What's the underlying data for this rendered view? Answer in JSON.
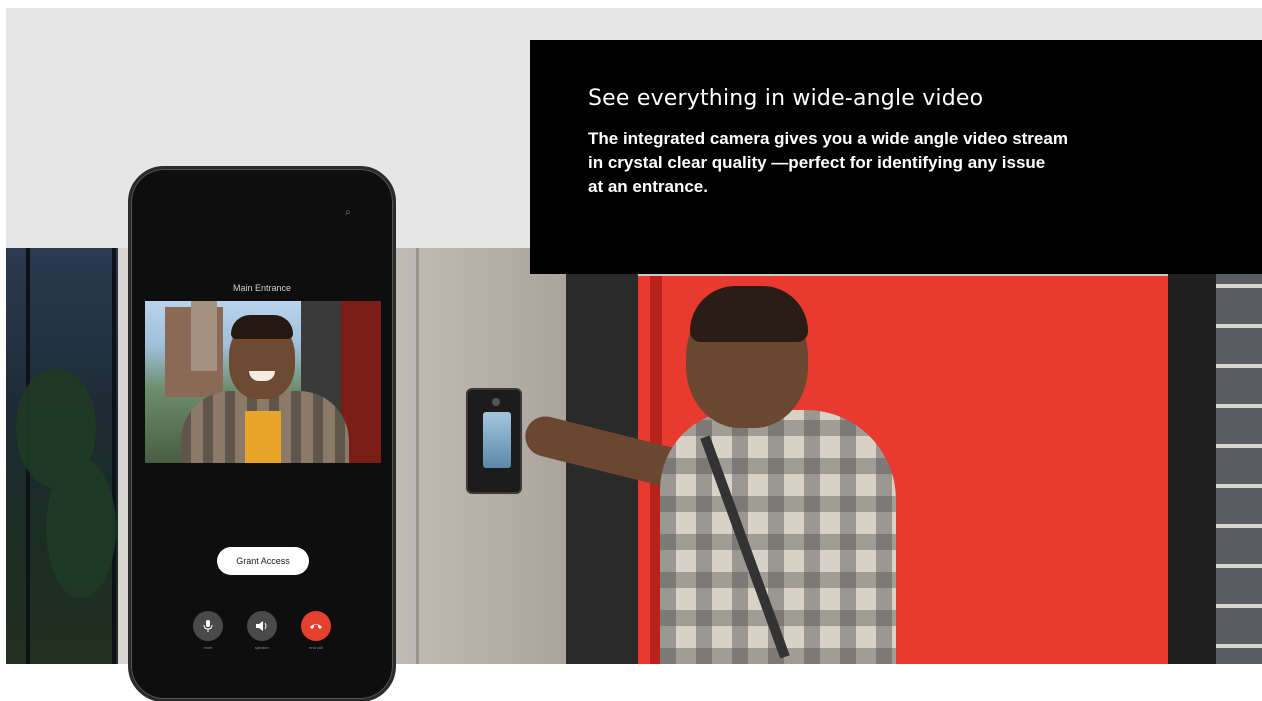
{
  "hero": {
    "heading": "See everything in wide-angle video",
    "body": "The integrated camera gives you a wide angle video stream\nin crystal clear quality —perfect for identifying any issue\n at an entrance."
  },
  "phone_app": {
    "entrance_label": "Main Entrance",
    "grant_access_label": "Grant Access",
    "controls": [
      {
        "icon": "microphone-icon",
        "label": "mute"
      },
      {
        "icon": "speaker-icon",
        "label": "speaker"
      },
      {
        "icon": "end-call-icon",
        "label": "end call"
      }
    ]
  },
  "colors": {
    "info_box_bg": "#000000",
    "top_band_bg": "#e6e6e6",
    "door_red": "#e83a2f",
    "end_call_red": "#e4412e"
  }
}
